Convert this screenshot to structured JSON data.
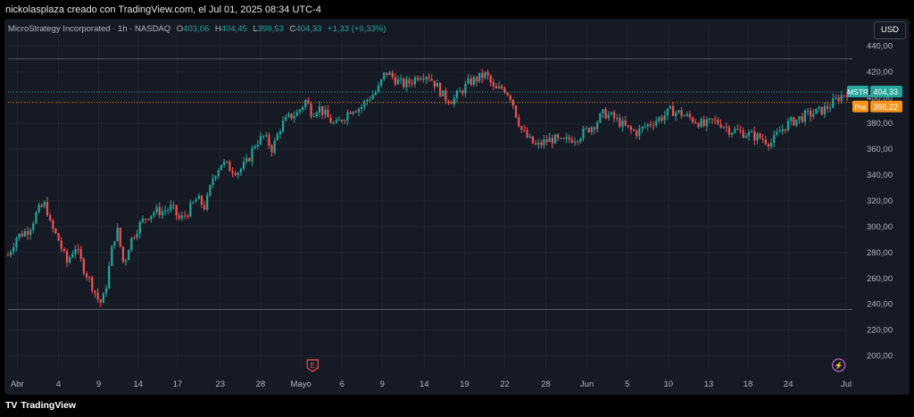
{
  "caption": "nickolasplaza creado con TradingView.com, el Jul 01, 2025 08:34 UTC-4",
  "legend": {
    "symbol": "MicroStrategy Incorporated · 1h · NASDAQ",
    "open_label": "O",
    "open": "403,06",
    "high_label": "H",
    "high": "404,45",
    "low_label": "L",
    "low": "399,53",
    "close_label": "C",
    "close": "404,33",
    "change": "+1,33 (+0,33%)"
  },
  "currency": "USD",
  "footer": {
    "brand": "TradingView"
  },
  "colors": {
    "background": "#161a25",
    "up": "#26a69a",
    "down": "#ef5350",
    "grid": "#1f2430",
    "axis_text": "#b2b5be",
    "pre": "#f7931a"
  },
  "chart_data": {
    "type": "candlestick",
    "ylim": [
      190,
      450
    ],
    "y_ticks": [
      "200,00",
      "220,00",
      "240,00",
      "260,00",
      "280,00",
      "300,00",
      "320,00",
      "340,00",
      "360,00",
      "380,00",
      "400,00",
      "420,00",
      "440,00"
    ],
    "y_tick_values": [
      200,
      220,
      240,
      260,
      280,
      300,
      320,
      340,
      360,
      380,
      400,
      420,
      440
    ],
    "x_ticks": [
      "Abr",
      "4",
      "9",
      "14",
      "17",
      "23",
      "28",
      "Mayo",
      "6",
      "9",
      "14",
      "19",
      "22",
      "28",
      "Jun",
      "5",
      "10",
      "13",
      "18",
      "24",
      "Jul"
    ],
    "x_tick_fraction": [
      0.011,
      0.06,
      0.108,
      0.155,
      0.202,
      0.253,
      0.301,
      0.349,
      0.398,
      0.446,
      0.496,
      0.544,
      0.592,
      0.641,
      0.69,
      0.738,
      0.787,
      0.835,
      0.882,
      0.93,
      0.999
    ],
    "last_price": {
      "label": "MSTR",
      "value": "404,33",
      "price": 404.33
    },
    "pre_market": {
      "label": "Pre",
      "value": "396,22",
      "price": 396.22
    },
    "horizontal_lines": [
      430,
      236
    ],
    "markers": [
      {
        "label": "E",
        "x_fraction": 0.363,
        "color": "#ef5350"
      },
      {
        "label": "⚡",
        "x_fraction": 0.99,
        "color": "#ba68c8"
      }
    ],
    "path": [
      [
        0,
        278
      ],
      [
        0.01,
        292
      ],
      [
        0.025,
        298
      ],
      [
        0.035,
        312
      ],
      [
        0.045,
        318
      ],
      [
        0.05,
        302
      ],
      [
        0.06,
        290
      ],
      [
        0.07,
        272
      ],
      [
        0.08,
        285
      ],
      [
        0.09,
        268
      ],
      [
        0.1,
        255
      ],
      [
        0.107,
        244
      ],
      [
        0.112,
        240
      ],
      [
        0.118,
        258
      ],
      [
        0.125,
        288
      ],
      [
        0.13,
        298
      ],
      [
        0.138,
        270
      ],
      [
        0.145,
        288
      ],
      [
        0.155,
        300
      ],
      [
        0.165,
        308
      ],
      [
        0.175,
        312
      ],
      [
        0.185,
        312
      ],
      [
        0.195,
        315
      ],
      [
        0.205,
        305
      ],
      [
        0.215,
        312
      ],
      [
        0.225,
        322
      ],
      [
        0.235,
        315
      ],
      [
        0.245,
        340
      ],
      [
        0.255,
        350
      ],
      [
        0.265,
        345
      ],
      [
        0.275,
        343
      ],
      [
        0.285,
        350
      ],
      [
        0.295,
        365
      ],
      [
        0.305,
        370
      ],
      [
        0.315,
        360
      ],
      [
        0.325,
        378
      ],
      [
        0.335,
        385
      ],
      [
        0.345,
        388
      ],
      [
        0.355,
        398
      ],
      [
        0.362,
        388
      ],
      [
        0.37,
        393
      ],
      [
        0.38,
        385
      ],
      [
        0.39,
        378
      ],
      [
        0.4,
        385
      ],
      [
        0.41,
        392
      ],
      [
        0.42,
        392
      ],
      [
        0.43,
        400
      ],
      [
        0.44,
        405
      ],
      [
        0.45,
        420
      ],
      [
        0.46,
        415
      ],
      [
        0.47,
        410
      ],
      [
        0.48,
        412
      ],
      [
        0.49,
        418
      ],
      [
        0.5,
        418
      ],
      [
        0.51,
        410
      ],
      [
        0.52,
        400
      ],
      [
        0.53,
        398
      ],
      [
        0.54,
        405
      ],
      [
        0.55,
        412
      ],
      [
        0.56,
        415
      ],
      [
        0.57,
        418
      ],
      [
        0.58,
        405
      ],
      [
        0.59,
        408
      ],
      [
        0.6,
        400
      ],
      [
        0.605,
        388
      ],
      [
        0.612,
        375
      ],
      [
        0.62,
        368
      ],
      [
        0.63,
        362
      ],
      [
        0.64,
        366
      ],
      [
        0.65,
        368
      ],
      [
        0.66,
        365
      ],
      [
        0.67,
        368
      ],
      [
        0.68,
        370
      ],
      [
        0.69,
        375
      ],
      [
        0.7,
        380
      ],
      [
        0.71,
        388
      ],
      [
        0.72,
        385
      ],
      [
        0.73,
        380
      ],
      [
        0.74,
        375
      ],
      [
        0.75,
        373
      ],
      [
        0.76,
        378
      ],
      [
        0.77,
        382
      ],
      [
        0.78,
        385
      ],
      [
        0.79,
        390
      ],
      [
        0.8,
        388
      ],
      [
        0.81,
        385
      ],
      [
        0.82,
        382
      ],
      [
        0.83,
        378
      ],
      [
        0.84,
        382
      ],
      [
        0.85,
        380
      ],
      [
        0.86,
        375
      ],
      [
        0.87,
        374
      ],
      [
        0.88,
        372
      ],
      [
        0.89,
        370
      ],
      [
        0.9,
        368
      ],
      [
        0.91,
        365
      ],
      [
        0.92,
        374
      ],
      [
        0.93,
        380
      ],
      [
        0.94,
        383
      ],
      [
        0.95,
        386
      ],
      [
        0.96,
        388
      ],
      [
        0.97,
        390
      ],
      [
        0.98,
        394
      ],
      [
        0.99,
        400
      ],
      [
        1.0,
        404.33
      ]
    ]
  }
}
